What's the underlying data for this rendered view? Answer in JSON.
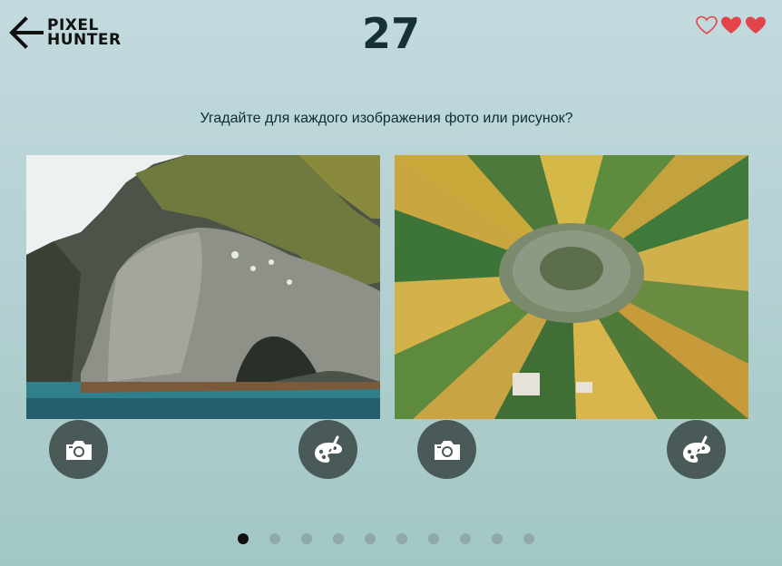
{
  "header": {
    "logo_line1": "PIXEL",
    "logo_line2": "HUNTER",
    "timer": "27",
    "lives": {
      "lost": 1,
      "remaining": 2
    }
  },
  "question": "Угадайте для каждого изображения фото или рисунок?",
  "options": [
    {
      "image": "elephant-rock-sea-cliff",
      "photo_icon": "camera-icon",
      "paint_icon": "palette-icon"
    },
    {
      "image": "aerial-circular-village-fields",
      "photo_icon": "camera-icon",
      "paint_icon": "palette-icon"
    }
  ],
  "progress": {
    "total": 10,
    "current": 1
  },
  "colors": {
    "heart": "#e2444a",
    "button": "#4a5a58",
    "timer": "#16303a"
  }
}
